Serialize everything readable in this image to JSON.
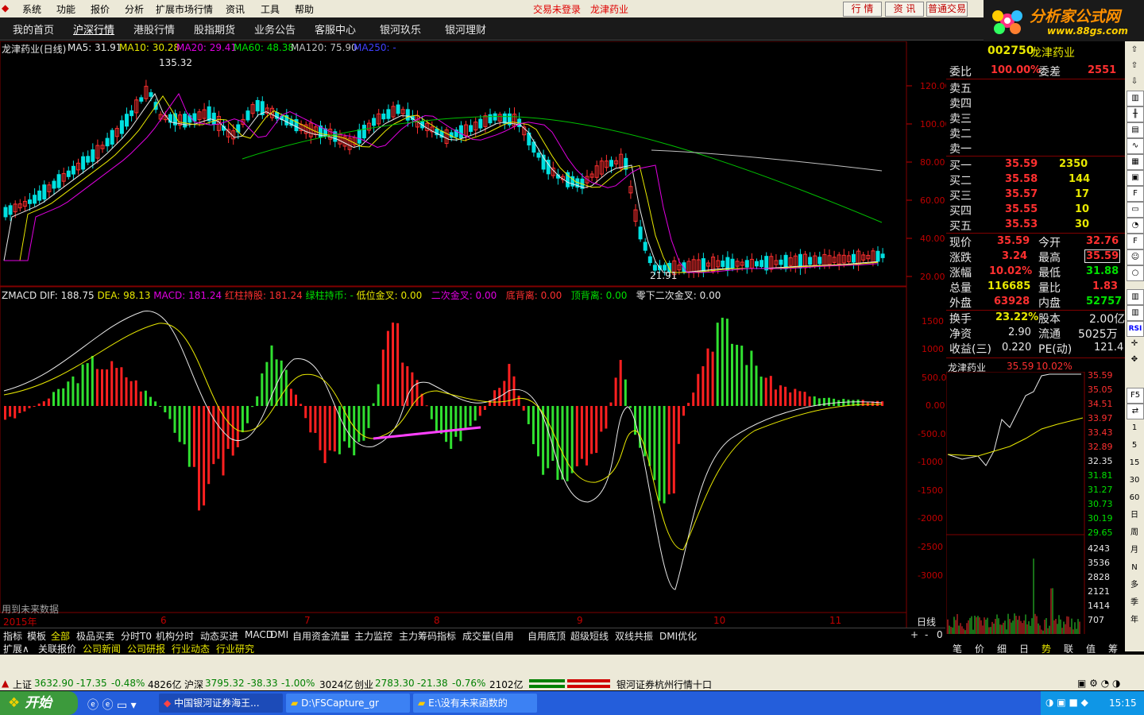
{
  "menu": {
    "items": [
      "系统",
      "功能",
      "报价",
      "分析",
      "扩展市场行情",
      "资讯",
      "工具",
      "帮助"
    ],
    "login_status": "交易未登录",
    "stock_title": "龙津药业",
    "btn_quote": "行 情",
    "btn_info": "资 讯",
    "btn_trade": "普通交易"
  },
  "logo": {
    "title": "分析家公式网",
    "url": "www.88gs.com"
  },
  "nav": [
    "我的首页",
    "沪深行情",
    "港股行情",
    "股指期货",
    "业务公告",
    "客服中心",
    "银河玖乐",
    "银河理财"
  ],
  "chart": {
    "stock_label": "龙津药业(日线)",
    "ma": [
      {
        "label": "MA5: 31.91",
        "color": "#e8e8e8"
      },
      {
        "label": "MA10: 30.28",
        "color": "#e8e800"
      },
      {
        "label": "MA20: 29.41",
        "color": "#e000e0"
      },
      {
        "label": "MA60: 48.38",
        "color": "#00e000"
      },
      {
        "label": "MA120: 75.90",
        "color": "#c0c0c0"
      },
      {
        "label": "MA250: -",
        "color": "#4040ff"
      }
    ],
    "high_label": "135.32",
    "low_label": "21.91",
    "price_ticks": [
      "120.00",
      "100.00",
      "80.00",
      "60.00",
      "40.00",
      "20.00"
    ],
    "macd_label_items": [
      {
        "label": "ZMACD DIF: 188.75",
        "color": "#e8e8e8"
      },
      {
        "label": "DEA: 98.13",
        "color": "#e8e800"
      },
      {
        "label": "MACD: 181.24",
        "color": "#e000e0"
      },
      {
        "label": "红柱持股: 181.24",
        "color": "#ff3030"
      },
      {
        "label": "绿柱持币: -",
        "color": "#00e000"
      },
      {
        "label": "低位金叉: 0.00",
        "color": "#e8e800"
      },
      {
        "label": "二次金叉: 0.00",
        "color": "#e000e0"
      },
      {
        "label": "底背离: 0.00",
        "color": "#ff3030"
      },
      {
        "label": "顶背离: 0.00",
        "color": "#00e000"
      },
      {
        "label": "零下二次金叉: 0.00",
        "color": "#e8e8e8"
      }
    ],
    "macd_ticks": [
      "1500",
      "1000",
      "500.0",
      "0.00",
      "-500.0",
      "-1000",
      "-1500",
      "-2000",
      "-2500",
      "-3000"
    ],
    "future_note": "用到未来数据",
    "x_labels": [
      "2015年",
      "6",
      "7",
      "8",
      "9",
      "10",
      "11"
    ],
    "period": "日线"
  },
  "quote": {
    "code": "002750",
    "name": "龙津药业",
    "webi_label": "委比",
    "webi_value": "100.00%",
    "weicha_label": "委差",
    "weicha_value": "2551",
    "sell": [
      {
        "label": "卖五"
      },
      {
        "label": "卖四"
      },
      {
        "label": "卖三"
      },
      {
        "label": "卖二"
      },
      {
        "label": "卖一"
      }
    ],
    "buy": [
      {
        "label": "买一",
        "price": "35.59",
        "vol": "2350"
      },
      {
        "label": "买二",
        "price": "35.58",
        "vol": "144"
      },
      {
        "label": "买三",
        "price": "35.57",
        "vol": "17"
      },
      {
        "label": "买四",
        "price": "35.55",
        "vol": "10"
      },
      {
        "label": "买五",
        "price": "35.53",
        "vol": "30"
      }
    ],
    "rows": [
      {
        "l1": "现价",
        "v1": "35.59",
        "l2": "今开",
        "v2": "32.76"
      },
      {
        "l1": "涨跌",
        "v1": "3.24",
        "l2": "最高",
        "v2": "35.59"
      },
      {
        "l1": "涨幅",
        "v1": "10.02%",
        "l2": "最低",
        "v2": "31.88"
      },
      {
        "l1": "总量",
        "v1": "116685",
        "l2": "量比",
        "v2": "1.83"
      },
      {
        "l1": "外盘",
        "v1": "63928",
        "l2": "内盘",
        "v2": "52757"
      },
      {
        "l1": "换手",
        "v1": "23.22%",
        "l2": "股本",
        "v2": "2.00亿"
      },
      {
        "l1": "净资",
        "v1": "2.90",
        "l2": "流通",
        "v2": "5025万"
      },
      {
        "l1": "收益(三)",
        "v1": "0.220",
        "l2": "PE(动)",
        "v2": "121.4"
      }
    ],
    "mini_title": "龙津药业",
    "mini_price": "35.59",
    "mini_pct": "10.02%",
    "mini_ticks": [
      "35.59",
      "35.05",
      "34.51",
      "33.97",
      "33.43",
      "32.89",
      "32.35",
      "31.81",
      "31.27",
      "30.73",
      "30.19",
      "29.65"
    ],
    "vol_ticks": [
      "4243",
      "3536",
      "2828",
      "2121",
      "1414",
      "707"
    ]
  },
  "right_toolbar": [
    "1",
    "5",
    "15",
    "30",
    "60",
    "日",
    "周",
    "月",
    "N",
    "多",
    "季",
    "年"
  ],
  "bottom_tabs": [
    "指标",
    "模板",
    "全部",
    "极品买卖",
    "分时T0",
    "机构分时",
    "动态买进",
    "MACD",
    "DMI",
    "自用资金流量",
    "主力监控",
    "主力筹码指标",
    "成交量(自用",
    "自用底顶",
    "超级短线",
    "双线共振",
    "DMI优化"
  ],
  "bottom_tabs_right": [
    "+",
    "-",
    "0"
  ],
  "info_tabs": [
    {
      "label": "扩展∧",
      "color": "#e8e8e8"
    },
    {
      "label": "关联报价",
      "color": "#e8e8e8"
    },
    {
      "label": "公司新闻",
      "color": "#e8e800"
    },
    {
      "label": "公司研报",
      "color": "#e8e800"
    },
    {
      "label": "行业动态",
      "color": "#e8e800"
    },
    {
      "label": "行业研究",
      "color": "#e8e800"
    }
  ],
  "right_tabs": [
    "笔",
    "价",
    "细",
    "日",
    "势",
    "联",
    "值",
    "筹"
  ],
  "status": {
    "sh_label": "上证",
    "sh_val": "3632.90",
    "sh_chg": "-17.35",
    "sh_pct": "-0.48%",
    "sh_amt": "4826亿",
    "hs_label": "沪深",
    "hs_val": "3795.32",
    "hs_chg": "-38.33",
    "hs_pct": "-1.00%",
    "hs_amt": "3024亿",
    "cy_label": "创业",
    "cy_val": "2783.30",
    "cy_chg": "-21.38",
    "cy_pct": "-0.76%",
    "cy_amt": "2102亿",
    "broker": "银河证券杭州行情十口"
  },
  "taskbar": {
    "start": "开始",
    "tasks": [
      "中国银河证券海王...",
      "D:\\FSCapture_gr",
      "E:\\没有未来函数的"
    ],
    "time": "15:15"
  },
  "colors": {
    "up": "#ff3030",
    "down": "#00e0e0",
    "green": "#00e000",
    "axis": "#c00000"
  }
}
